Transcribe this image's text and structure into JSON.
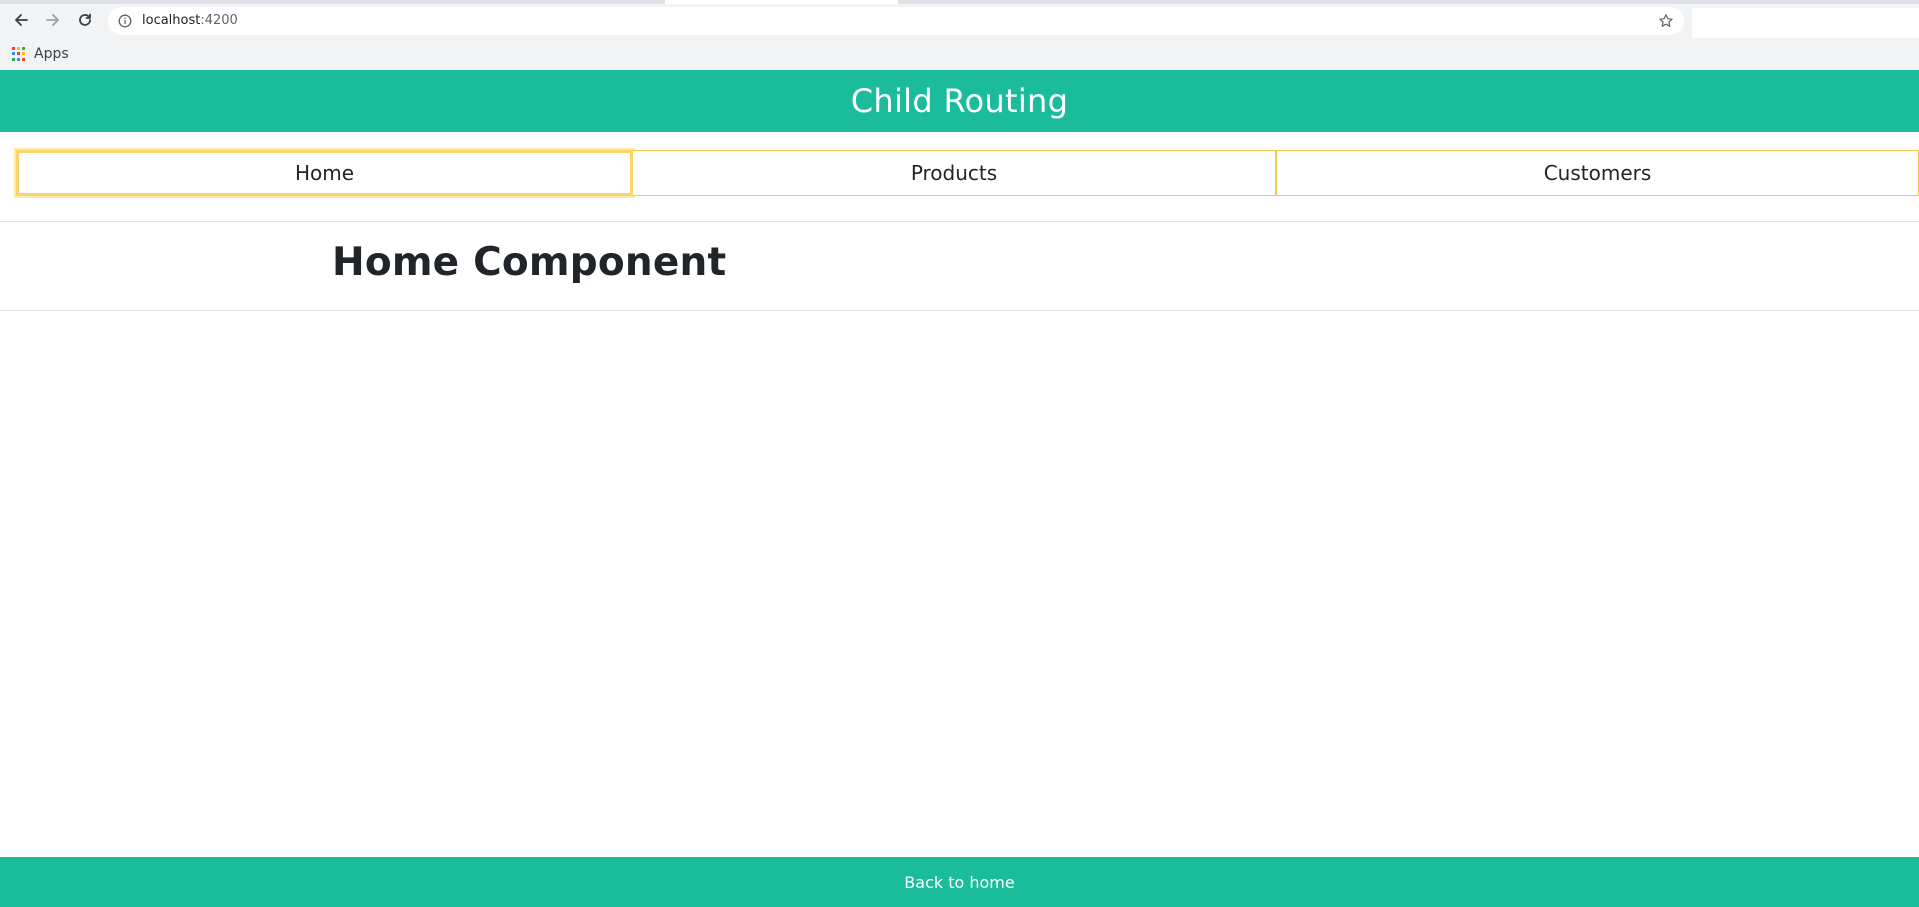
{
  "browser": {
    "url_host": "localhost",
    "url_port": ":4200",
    "bookmarks": [
      {
        "label": "Apps",
        "icon": "apps-grid-icon"
      }
    ],
    "icons": {
      "back": "back-arrow-icon",
      "forward": "forward-arrow-icon",
      "reload": "reload-icon",
      "info": "info-icon",
      "bookmark_star": "star-icon"
    }
  },
  "app": {
    "title": "Child Routing",
    "nav": [
      {
        "label": "Home",
        "active": true
      },
      {
        "label": "Products",
        "active": false
      },
      {
        "label": "Customers",
        "active": false
      }
    ],
    "content_heading": "Home Component",
    "footer_link": "Back to home"
  },
  "colors": {
    "brand": "#1abc9c",
    "nav_border": "#f7c948",
    "text": "#212529"
  }
}
